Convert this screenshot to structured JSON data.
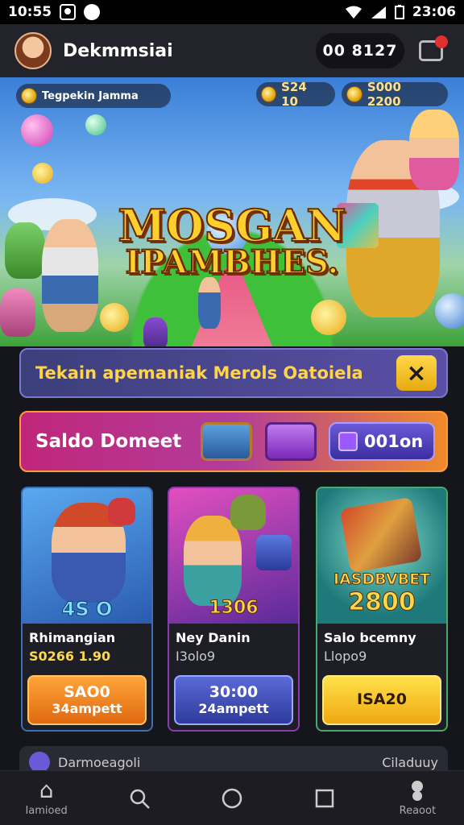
{
  "status_bar": {
    "time": "10:55",
    "clock": "23:06"
  },
  "header": {
    "app_name": "Dekmmsiai",
    "balance": "00 8127"
  },
  "hero": {
    "left_pill": "Tegpekin Jamma",
    "coins_1": "S24 10",
    "coins_2": "S000 2200",
    "title_line1": "MOSGAN",
    "title_line2": "IPAMBHES."
  },
  "notice": {
    "text": "Tekain apemaniak Merols Oatoiela",
    "close": "×"
  },
  "balance_bar": {
    "label": "Saldo Domeet",
    "value": "001on"
  },
  "cards": [
    {
      "badge": "4S O",
      "name": "Rhimangian",
      "price": "S0266  1.90",
      "cta_line1": "SAO0",
      "cta_line2": "34ampett"
    },
    {
      "badge": "1306",
      "name": "Ney Danin",
      "price": "I3olo9",
      "cta_line1": "30:00",
      "cta_line2": "24ampett"
    },
    {
      "badge_line1": "IASDBVBET",
      "badge_line2": "2800",
      "name": "Salo bcemny",
      "price": "Llopo9",
      "cta_line1": "ISA20",
      "cta_line2": ""
    }
  ],
  "peek": {
    "left": "Darmoeagoli",
    "right": "Ciladuuy"
  },
  "nav": [
    {
      "label": "Iamioed",
      "icon": "home-icon"
    },
    {
      "label": "",
      "icon": "search-icon"
    },
    {
      "label": "",
      "icon": "circle-icon"
    },
    {
      "label": "",
      "icon": "square-icon"
    },
    {
      "label": "Reaoot",
      "icon": "controller-icon"
    }
  ]
}
